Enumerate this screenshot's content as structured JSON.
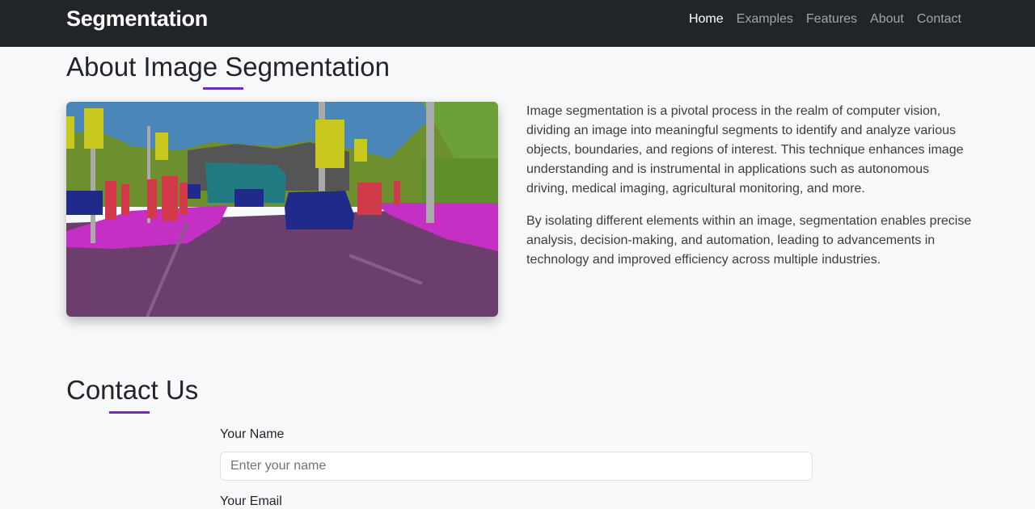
{
  "navbar": {
    "brand": "Segmentation",
    "links": [
      {
        "label": "Home",
        "active": true
      },
      {
        "label": "Examples",
        "active": false
      },
      {
        "label": "Features",
        "active": false
      },
      {
        "label": "About",
        "active": false
      },
      {
        "label": "Contact",
        "active": false
      }
    ]
  },
  "about": {
    "title": "About Image Segmentation",
    "paragraphs": [
      "Image segmentation is a pivotal process in the realm of computer vision, dividing an image into meaningful segments to identify and analyze various objects, boundaries, and regions of interest. This technique enhances image understanding and is instrumental in applications such as autonomous driving, medical imaging, agricultural monitoring, and more.",
      "By isolating different elements within an image, segmentation enables precise analysis, decision-making, and automation, leading to advancements in technology and improved efficiency across multiple industries."
    ]
  },
  "contact": {
    "title": "Contact Us",
    "name_label": "Your Name",
    "name_placeholder": "Enter your name",
    "email_label": "Your Email"
  },
  "colors": {
    "accent": "#6f2dbd",
    "navbar_bg": "#212529",
    "page_bg": "#f8f9fa"
  }
}
